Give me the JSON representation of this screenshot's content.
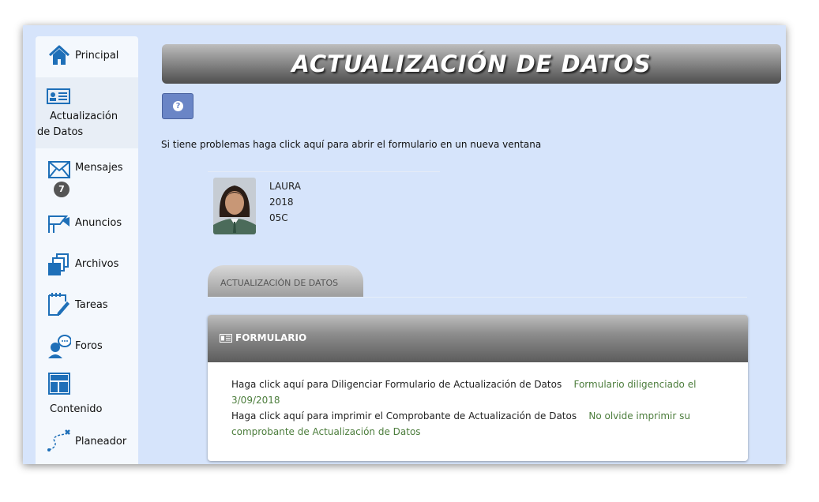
{
  "sidebar": {
    "items": [
      {
        "label": "Principal",
        "icon": "house-icon"
      },
      {
        "label": "Actualización de Datos",
        "line1": "Actualización",
        "line2": "de Datos",
        "icon": "id-card-icon"
      },
      {
        "label": "Mensajes",
        "icon": "envelope-icon",
        "badge": "7"
      },
      {
        "label": "Anuncios",
        "icon": "megaphone-icon"
      },
      {
        "label": "Archivos",
        "icon": "files-icon"
      },
      {
        "label": "Tareas",
        "icon": "calendar-edit-icon"
      },
      {
        "label": "Foros",
        "icon": "forum-user-icon"
      },
      {
        "label": "Contenido",
        "icon": "layout-icon"
      },
      {
        "label": "Planeador",
        "icon": "route-icon"
      }
    ]
  },
  "main": {
    "title": "ACTUALIZACIÓN DE DATOS",
    "help_icon": "question-circle-icon",
    "notice": "Si tiene problemas haga click aquí para abrir el formulario en un nueva ventana"
  },
  "student": {
    "name": "LAURA",
    "year": "2018",
    "group": "05C"
  },
  "tab": {
    "label": "ACTUALIZACIÓN DE DATOS"
  },
  "panel": {
    "title": "FORMULARIO",
    "icon": "id-card-icon",
    "line1_link": "Haga click aquí para Diligenciar Formulario de Actualización de Datos",
    "line1_status": "Formulario diligenciado el 3/09/2018",
    "line2_link": "Haga click aquí para imprimir el Comprobante de Actualización de Datos",
    "line2_status": "No olvide imprimir su comprobante de Actualización de Datos"
  },
  "colors": {
    "frame_bg": "#d6e4fb",
    "sidebar_icon": "#1e6fb8",
    "button": "#6a85c6",
    "status_green": "#4c7d3c"
  }
}
